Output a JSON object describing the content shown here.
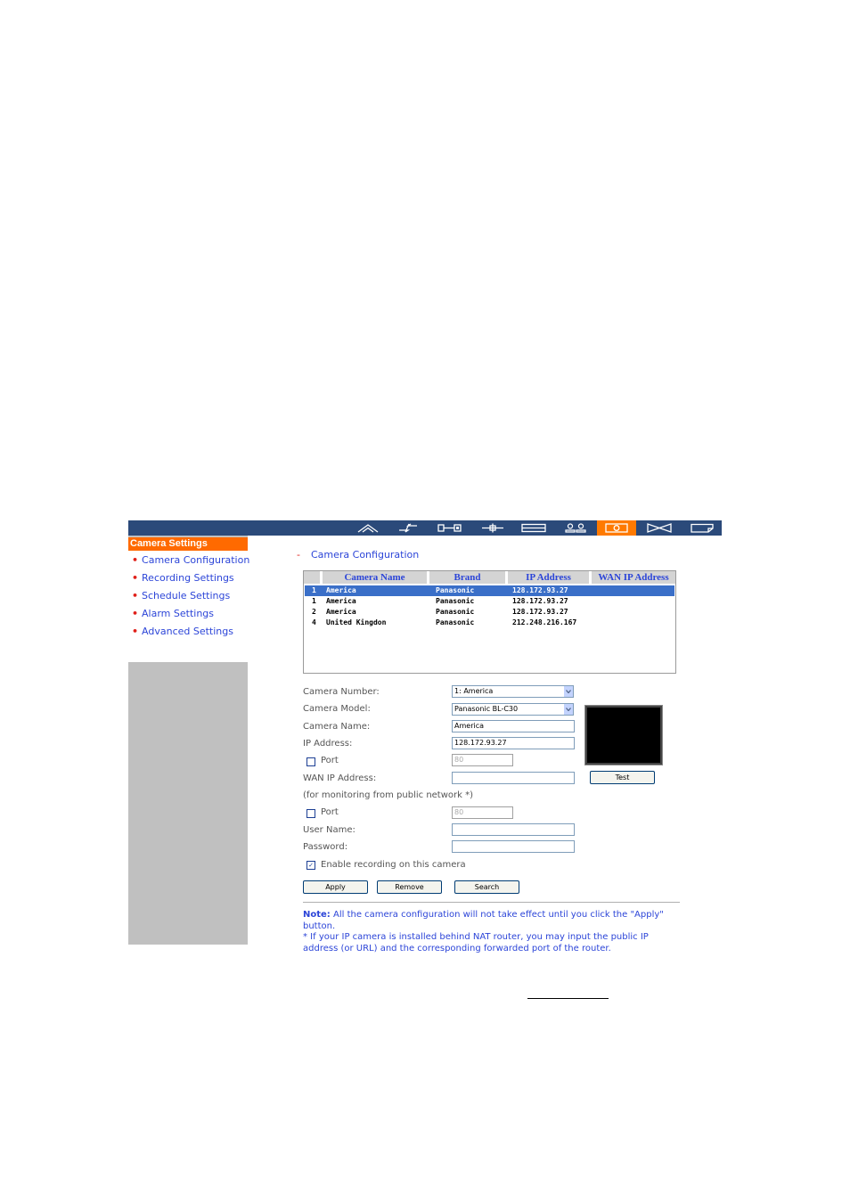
{
  "sidebar": {
    "title": "Camera Settings",
    "items": [
      {
        "label": "Camera Configuration"
      },
      {
        "label": "Recording Settings"
      },
      {
        "label": "Schedule Settings"
      },
      {
        "label": "Alarm Settings"
      },
      {
        "label": "Advanced Settings"
      }
    ]
  },
  "nav": {
    "icons": [
      "home-icon",
      "lightning-icon",
      "network-icon",
      "plus-icon",
      "list-icon",
      "users-icon",
      "camera-icon",
      "bowtie-icon",
      "note-icon"
    ],
    "active": "camera-icon",
    "active_color": "#ff7a00",
    "bar_color": "#2b4a7a"
  },
  "main": {
    "title": "Camera Configuration",
    "table": {
      "columns": [
        "Camera Name",
        "Brand",
        "IP Address",
        "WAN IP Address"
      ],
      "rows": [
        {
          "num": "1",
          "name": "America",
          "brand": "Panasonic",
          "ip": "128.172.93.27",
          "wan": ""
        },
        {
          "num": "1",
          "name": "America",
          "brand": "Panasonic",
          "ip": "128.172.93.27",
          "wan": ""
        },
        {
          "num": "2",
          "name": "America",
          "brand": "Panasonic",
          "ip": "128.172.93.27",
          "wan": ""
        },
        {
          "num": "4",
          "name": "United Kingdon",
          "brand": "Panasonic",
          "ip": "212.248.216.167",
          "wan": ""
        }
      ]
    },
    "form": {
      "camera_number_label": "Camera Number:",
      "camera_number_value": "1: America",
      "camera_model_label": "Camera Model:",
      "camera_model_value": "Panasonic BL-C30",
      "camera_name_label": "Camera Name:",
      "camera_name_value": "America",
      "ip_address_label": "IP Address:",
      "ip_address_value": "128.172.93.27",
      "port_label": "Port",
      "port_value": "80",
      "wan_ip_label": "WAN IP Address:",
      "wan_ip_value": "",
      "public_note": "(for monitoring from public network *)",
      "port2_label": "Port",
      "port2_value": "80",
      "user_name_label": "User Name:",
      "user_name_value": "",
      "password_label": "Password:",
      "password_value": "",
      "enable_recording_label": "Enable recording on this camera",
      "test_button": "Test"
    },
    "buttons": {
      "apply": "Apply",
      "remove": "Remove",
      "search": "Search"
    },
    "note": {
      "prefix": "Note:",
      "line1": " All the camera configuration will not take effect until you click the \"Apply\" button.",
      "line2": "* If your IP camera is installed behind NAT router, you may input the public IP address (or URL) and the corresponding forwarded port of the router."
    }
  }
}
